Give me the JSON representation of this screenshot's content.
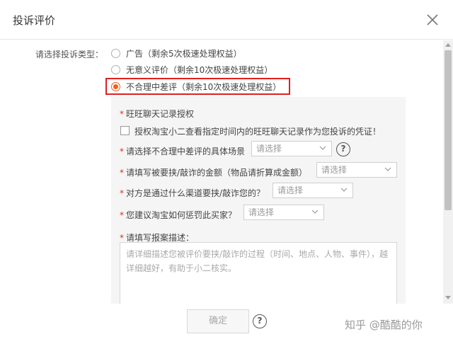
{
  "dialog": {
    "title": "投诉评价",
    "close_icon": "close-icon"
  },
  "complaint_type": {
    "label": "请选择投诉类型：",
    "options": [
      {
        "label": "广告（剩余5次极速处理权益）",
        "checked": false
      },
      {
        "label": "无意义评价（剩余10次极速处理权益）",
        "checked": false
      },
      {
        "label": "不合理中差评（剩余10次极速处理权益）",
        "checked": true
      }
    ]
  },
  "panel": {
    "auth_title": "旺旺聊天记录授权",
    "auth_checkbox_label": "授权淘宝小二查看指定时间内的旺旺聊天记录作为您投诉的凭证！",
    "fields": [
      {
        "label": "请选择不合理中差评的具体场景",
        "placeholder": "请选择"
      },
      {
        "label": "请填写被要挟/敲诈的金额（物品请折算成金额）",
        "placeholder": "请选择"
      },
      {
        "label": "对方是通过什么渠道要挟/敲诈您的？",
        "placeholder": "请选择"
      },
      {
        "label": "您建议淘宝如何惩罚此买家？",
        "placeholder": "请选择"
      }
    ],
    "report_label": "请填写报案描述：",
    "report_placeholder": "请详细描述您被评价要挟/敲诈的过程（时间、地点、人物、事件），越详细越好，有助于小二核实。"
  },
  "footer": {
    "confirm_label": "确定",
    "help": "?"
  },
  "watermark": "知乎 @酷酷的你",
  "colors": {
    "accent": "#f06020",
    "highlight_border": "#e02020",
    "required": "#e0301e"
  }
}
